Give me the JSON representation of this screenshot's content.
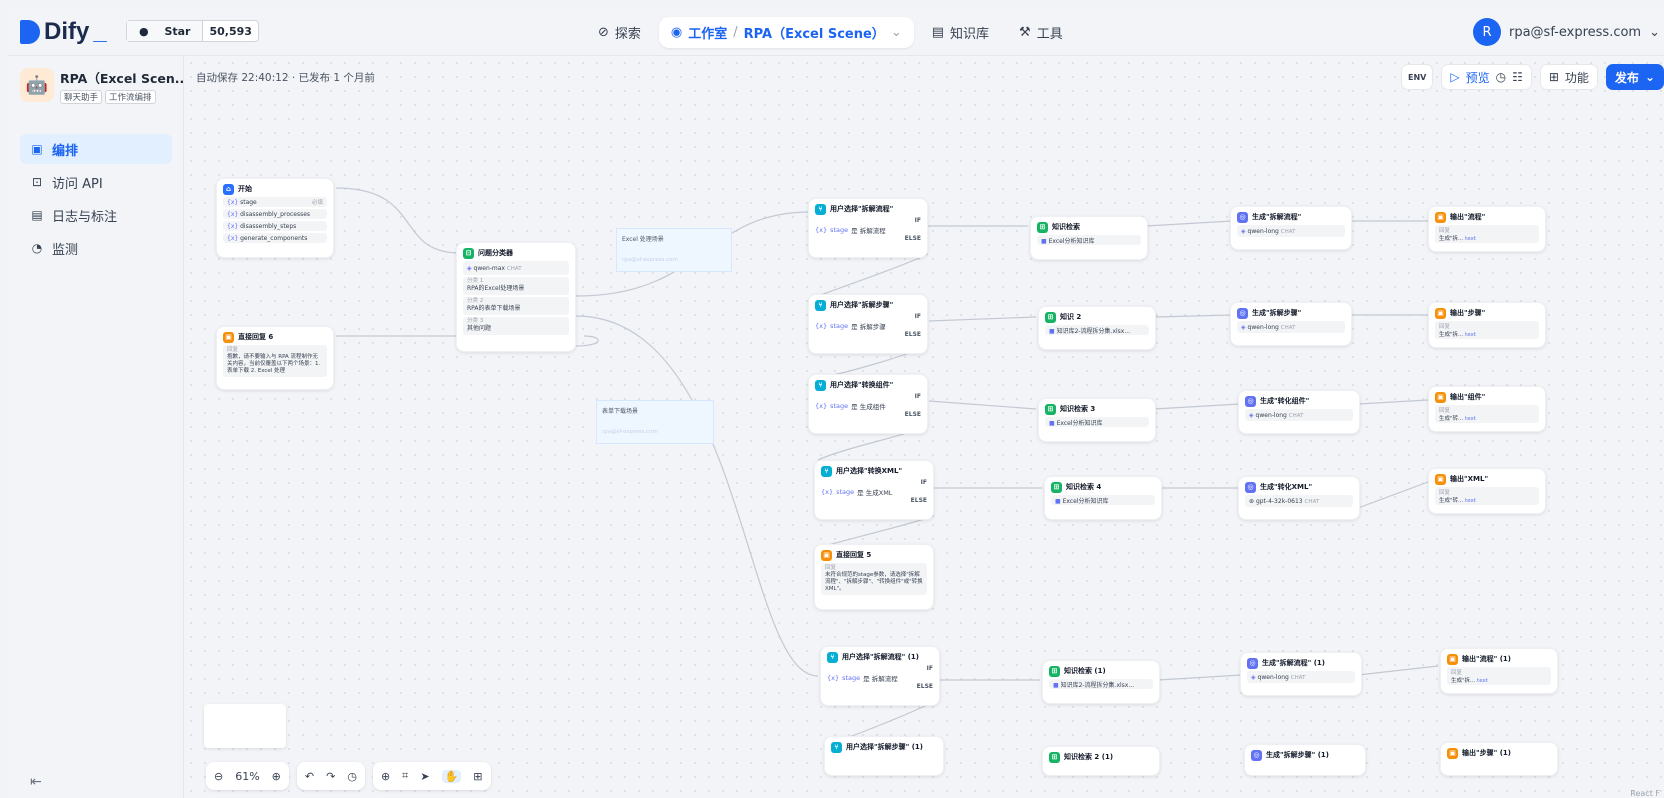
{
  "app": {
    "logo": "Dify",
    "github_star_label": "Star",
    "github_star_count": "50,593"
  },
  "nav": {
    "explore": "探索",
    "studio": "工作室",
    "current_app": "RPA（Excel Scene）",
    "knowledge": "知识库",
    "tools": "工具"
  },
  "user": {
    "avatar_letter": "R",
    "email": "rpa@sf-express.com"
  },
  "sidebar": {
    "app_name": "RPA（Excel Scen...",
    "tags": [
      "聊天助手",
      "工作流编排"
    ],
    "items": [
      {
        "label": "编排",
        "icon": "layout-icon",
        "active": true
      },
      {
        "label": "访问 API",
        "icon": "terminal-icon"
      },
      {
        "label": "日志与标注",
        "icon": "file-list-icon"
      },
      {
        "label": "监测",
        "icon": "dashboard-icon"
      }
    ]
  },
  "canvas": {
    "autosave": "自动保存 22:40:12 · 已发布 1 个月前",
    "zoom": "61%"
  },
  "toolbar": {
    "env": "ENV",
    "preview": "预览",
    "features": "功能",
    "publish": "发布"
  },
  "nodes": {
    "start": {
      "title": "开始",
      "vars": [
        "stage",
        "disassembly_processes",
        "disassembly_steps",
        "generate_components"
      ],
      "required": "必填"
    },
    "classifier": {
      "title": "问题分类器",
      "model": "qwen-max",
      "model_tag": "CHAT",
      "classes": [
        {
          "label": "分类 1",
          "text": "RPA的Excel处理场景"
        },
        {
          "label": "分类 2",
          "text": "RPA的表单下载场景"
        },
        {
          "label": "分类 3",
          "text": "其他问题"
        }
      ]
    },
    "direct6": {
      "title": "直接回复 6",
      "label": "回复",
      "text": "抱歉，请不要输入与 RPA 流程制作无关内容，当前仅覆盖以下两个场景：1. 表单下载 2. Excel 处理"
    },
    "note1": {
      "title": "Excel 处理场景",
      "author": "rpa@sf-express.com"
    },
    "note2": {
      "title": "表单下载场景",
      "author": "rpa@sf-express.com"
    },
    "ifs": [
      {
        "title": "用户选择\"拆解流程\"",
        "cond": "是 拆解流程"
      },
      {
        "title": "用户选择\"拆解步骤\"",
        "cond": "是 拆解步骤"
      },
      {
        "title": "用户选择\"转换组件\"",
        "cond": "是 生成组件"
      },
      {
        "title": "用户选择\"转换XML\"",
        "cond": "是 生成XML"
      },
      {
        "title": "用户选择\"拆解流程\" (1)",
        "cond": "是 拆解流程"
      },
      {
        "title": "用户选择\"拆解步骤\" (1)",
        "cond": ""
      }
    ],
    "if_var": "stage",
    "if_label": "IF",
    "else_label": "ELSE",
    "direct5": {
      "title": "直接回复 5",
      "label": "回复",
      "text": "未符合规范的stage参数，请选择\"拆解流程\"、\"拆解步骤\"、\"转换组件\"或\"转换XML\"。"
    },
    "kbs": [
      {
        "title": "知识检索",
        "kb": "Excel分析知识库"
      },
      {
        "title": "知识 2",
        "kb": "知识库2-流程拆分集.xlsx..."
      },
      {
        "title": "知识检索 3",
        "kb": "Excel分析知识库"
      },
      {
        "title": "知识检索 4",
        "kb": "Excel分析知识库"
      },
      {
        "title": "知识检索 (1)",
        "kb": "知识库2-流程拆分集.xlsx..."
      },
      {
        "title": "知识检索 2 (1)",
        "kb": ""
      }
    ],
    "llms": [
      {
        "title": "生成\"拆解流程\"",
        "model": "qwen-long"
      },
      {
        "title": "生成\"拆解步骤\"",
        "model": "qwen-long"
      },
      {
        "title": "生成\"转化组件\"",
        "model": "qwen-long"
      },
      {
        "title": "生成\"转化XML\"",
        "model": "gpt-4-32k-0613"
      },
      {
        "title": "生成\"拆解流程\" (1)",
        "model": "qwen-long"
      },
      {
        "title": "生成\"拆解步骤\" (1)",
        "model": ""
      }
    ],
    "llm_tag": "CHAT",
    "answers": [
      {
        "title": "输出\"流程\"",
        "ref": "生成\"拆..."
      },
      {
        "title": "输出\"步骤\"",
        "ref": "生成\"拆..."
      },
      {
        "title": "输出\"组件\"",
        "ref": "生成\"转..."
      },
      {
        "title": "输出\"XML\"",
        "ref": "生成\"转..."
      },
      {
        "title": "输出\"流程\" (1)",
        "ref": "生成\"拆..."
      },
      {
        "title": "输出\"步骤\" (1)",
        "ref": ""
      }
    ],
    "answer_label": "回复",
    "answer_var": "text"
  },
  "footer": {
    "react_flow": "React F"
  }
}
